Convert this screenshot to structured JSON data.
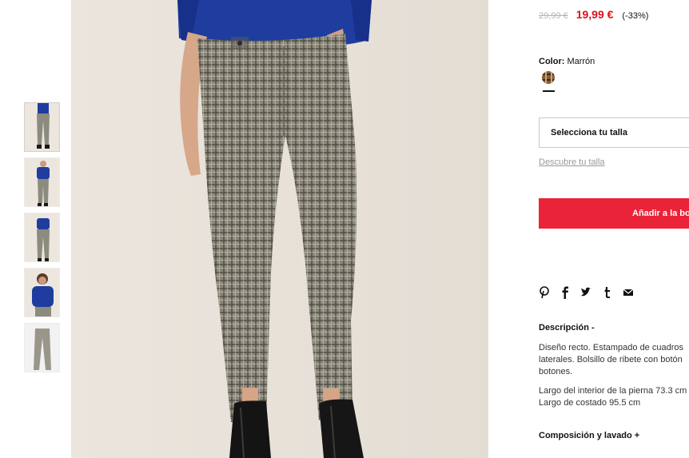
{
  "product": {
    "old_price": "29,99 €",
    "new_price": "19,99 €",
    "discount": "(-33%)",
    "color_label": "Color:",
    "color_value": "Marrón",
    "size_placeholder": "Selecciona tu talla",
    "size_guide_link": "Descubre tu talla",
    "add_to_bag": "Añadir a la bolsa",
    "description_title": "Descripción -",
    "description_lines": [
      "Diseño recto. Estampado de cuadros",
      "laterales. Bolsillo de ribete con botón",
      "botones."
    ],
    "measure_lines": [
      "Largo del interior de la pierna 73.3 cm",
      "Largo de costado 95.5 cm"
    ],
    "composition_title": "Composición y lavado +"
  },
  "social": [
    "pinterest-icon",
    "facebook-icon",
    "twitter-icon",
    "tumblr-icon",
    "email-icon"
  ],
  "colors": {
    "price_red": "#e20d18",
    "button_red": "#ea2338",
    "sweater_blue": "#1f3d9e",
    "plaid_base": "#8d8b7e"
  },
  "thumbnails": [
    "full-front",
    "sweater-front",
    "trousers-back",
    "sweater-closeup",
    "trousers-flat"
  ]
}
